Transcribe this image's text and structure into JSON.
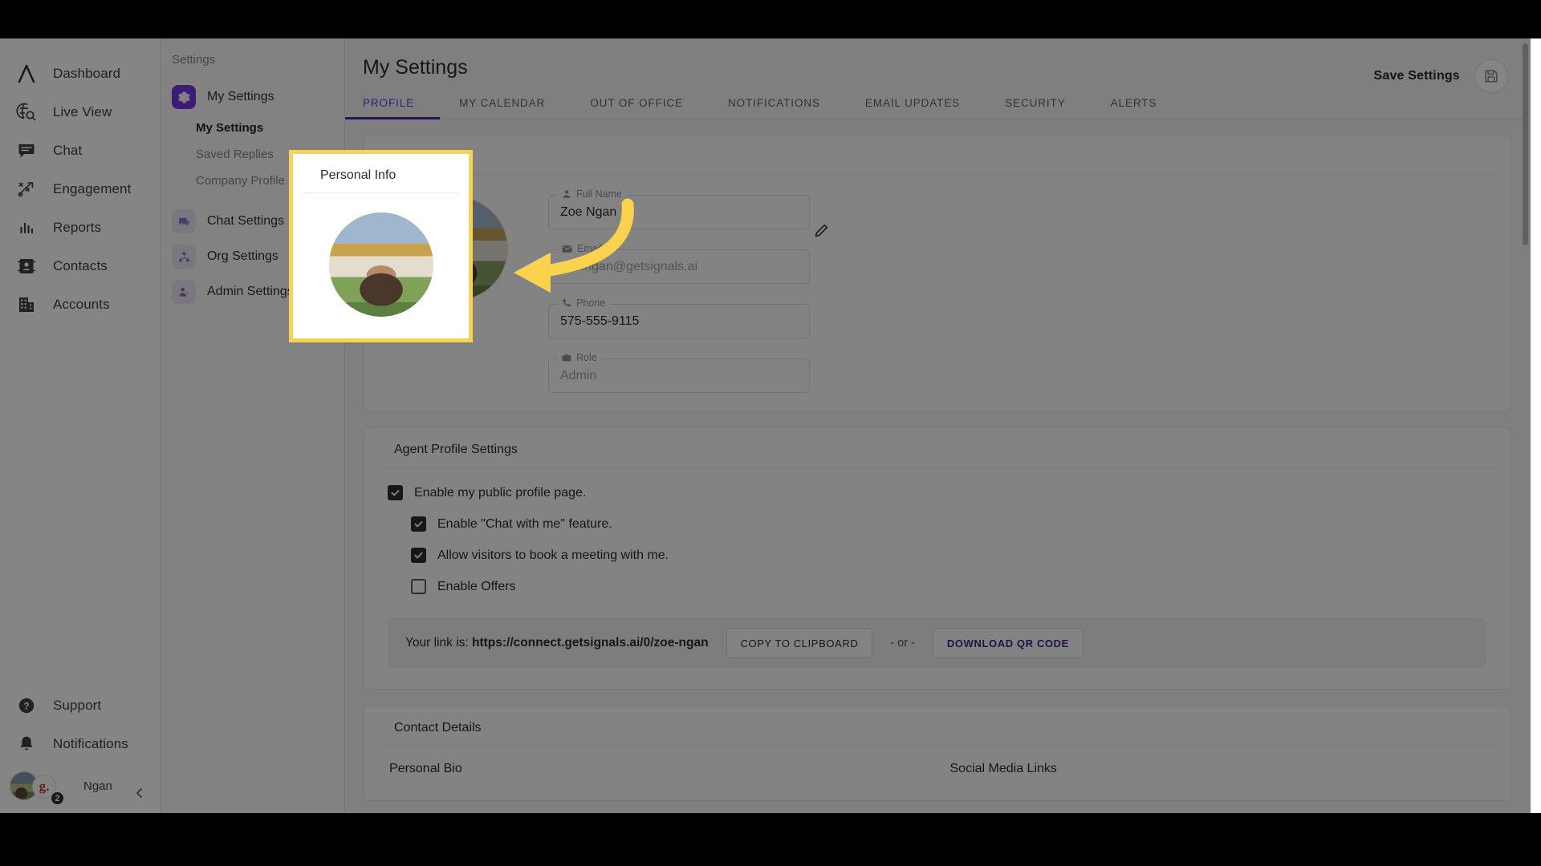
{
  "rail": {
    "items": [
      {
        "label": "Dashboard",
        "icon": "logo-a-icon"
      },
      {
        "label": "Live View",
        "icon": "globe-search-icon"
      },
      {
        "label": "Chat",
        "icon": "chat-bubble-icon"
      },
      {
        "label": "Engagement",
        "icon": "engagement-icon"
      },
      {
        "label": "Reports",
        "icon": "bar-chart-icon"
      },
      {
        "label": "Contacts",
        "icon": "contact-card-icon"
      },
      {
        "label": "Accounts",
        "icon": "building-icon"
      }
    ],
    "bottom": [
      {
        "label": "Support",
        "icon": "help-circle-icon"
      },
      {
        "label": "Notifications",
        "icon": "bell-icon"
      }
    ],
    "user": {
      "name": "Ngan",
      "badge_count": "2",
      "grammarly_letter": "g."
    }
  },
  "subnav": {
    "title": "Settings",
    "groups": [
      {
        "label": "My Settings",
        "icon": "gear-icon",
        "active": true,
        "children": [
          {
            "label": "My Settings",
            "current": true
          },
          {
            "label": "Saved Replies",
            "current": false
          },
          {
            "label": "Company Profile",
            "current": false
          }
        ]
      },
      {
        "label": "Chat Settings",
        "icon": "chat-settings-icon",
        "active": false,
        "children": []
      },
      {
        "label": "Org Settings",
        "icon": "org-icon",
        "active": false,
        "children": []
      },
      {
        "label": "Admin Settings",
        "icon": "admin-icon",
        "active": false,
        "children": []
      }
    ]
  },
  "header": {
    "title": "My Settings",
    "save_label": "Save Settings",
    "save_icon": "save-disk-icon"
  },
  "tabs": [
    {
      "label": "PROFILE",
      "active": true
    },
    {
      "label": "MY CALENDAR",
      "active": false
    },
    {
      "label": "OUT OF OFFICE",
      "active": false
    },
    {
      "label": "NOTIFICATIONS",
      "active": false
    },
    {
      "label": "EMAIL UPDATES",
      "active": false
    },
    {
      "label": "SECURITY",
      "active": false
    },
    {
      "label": "ALERTS",
      "active": false
    }
  ],
  "personal_info": {
    "title": "Personal Info",
    "photo_alt": "profile-photo",
    "edit_icon": "pencil-icon",
    "fields": [
      {
        "legend": "Full Name",
        "icon": "person-icon",
        "value": "Zoe Ngan",
        "is_placeholder": false
      },
      {
        "legend": "Email",
        "icon": "envelope-icon",
        "value": "zoe.ngan@getsignals.ai",
        "is_placeholder": true
      },
      {
        "legend": "Phone",
        "icon": "phone-icon",
        "value": "575-555-9115",
        "is_placeholder": false
      },
      {
        "legend": "Role",
        "icon": "briefcase-icon",
        "value": "Admin",
        "is_placeholder": true
      }
    ]
  },
  "agent_profile": {
    "title": "Agent Profile Settings",
    "checkboxes": [
      {
        "label": "Enable my public profile page.",
        "checked": true,
        "indent": false
      },
      {
        "label": "Enable \"Chat with me\" feature.",
        "checked": true,
        "indent": true
      },
      {
        "label": "Allow visitors to book a meeting with me.",
        "checked": true,
        "indent": true
      },
      {
        "label": "Enable Offers",
        "checked": false,
        "indent": true
      }
    ],
    "link_prefix": "Your link is:",
    "link_url": "https://connect.getsignals.ai/0/zoe-ngan",
    "copy_button": "COPY TO CLIPBOARD",
    "or_text": "- or -",
    "qr_button": "DOWNLOAD QR CODE"
  },
  "contact_details": {
    "title": "Contact Details",
    "col_left": "Personal Bio",
    "col_right": "Social Media Links"
  },
  "annotation": {
    "highlight_color": "#fbd24e",
    "arrow_color": "#fbd24e",
    "arrow_icon": "curved-arrow-left-icon"
  },
  "colors": {
    "accent_purple": "#7b2ff7",
    "tab_underline": "#5b21b6",
    "page_bg": "#f4f4f6"
  }
}
